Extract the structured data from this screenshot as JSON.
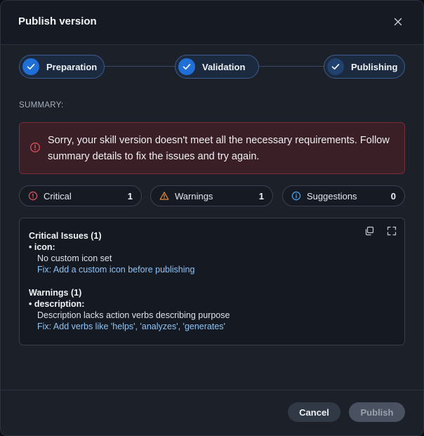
{
  "dialog": {
    "title": "Publish version"
  },
  "stepper": {
    "steps": [
      {
        "label": "Preparation",
        "status": "complete"
      },
      {
        "label": "Validation",
        "status": "complete"
      },
      {
        "label": "Publishing",
        "status": "current"
      }
    ]
  },
  "summary": {
    "label": "SUMMARY:",
    "error_message": "Sorry, your skill version doesn't meet all the necessary requirements. Follow summary details to fix the issues and try again."
  },
  "counts": [
    {
      "label": "Critical",
      "count": "1",
      "icon": "critical-icon",
      "color": "#e0505e"
    },
    {
      "label": "Warnings",
      "count": "1",
      "icon": "warning-icon",
      "color": "#e8883a"
    },
    {
      "label": "Suggestions",
      "count": "0",
      "icon": "info-icon",
      "color": "#4aa3ef"
    }
  ],
  "details": {
    "critical_title": "Critical Issues (1)",
    "critical_field": "• icon:",
    "critical_desc": "No custom icon set",
    "critical_fix": "Fix: Add a custom icon before publishing",
    "warnings_title": "Warnings (1)",
    "warnings_field": "• description:",
    "warnings_desc": "Description lacks action verbs describing purpose",
    "warnings_fix": "Fix: Add verbs like 'helps', 'analyzes', 'generates'"
  },
  "footer": {
    "cancel_label": "Cancel",
    "publish_label": "Publish"
  },
  "colors": {
    "accent": "#1f6fd6",
    "error_border": "#7a2d35",
    "fix_text": "#8ec3f5"
  }
}
